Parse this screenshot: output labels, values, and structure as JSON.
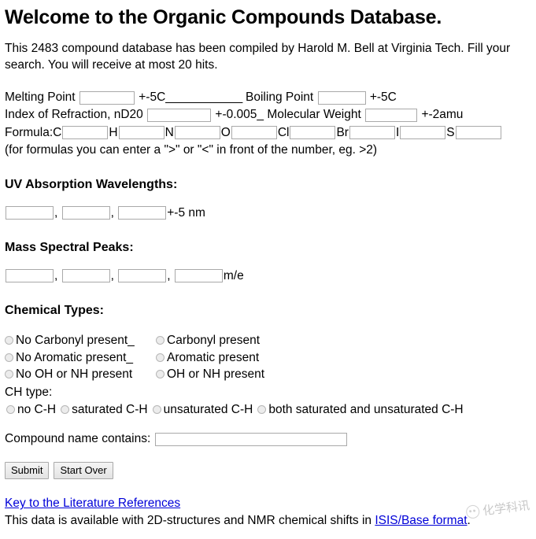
{
  "page": {
    "title": "Welcome to the Organic Compounds Database.",
    "intro": "This 2483 compound database has been compiled by Harold M. Bell at Virginia Tech. Fill your search. You will receive at most 20 hits."
  },
  "physical": {
    "melting_point_label": "Melting Point",
    "melting_point_value": "",
    "melting_point_tolerance": "+-5C",
    "spacer_underscores": "____________",
    "boiling_point_label": "Boiling Point",
    "boiling_point_value": "",
    "boiling_point_tolerance": "+-5C",
    "refraction_label": "Index of Refraction, nD20",
    "refraction_value": "",
    "refraction_tolerance": "+-0.005_",
    "molecular_weight_label": "Molecular Weight",
    "molecular_weight_value": "",
    "molecular_weight_tolerance": "+-2amu"
  },
  "formula": {
    "label": "Formula:",
    "note": "(for formulas you can enter a \">\" or \"<\" in front of the number, eg. >2)",
    "elements": [
      {
        "symbol": "C",
        "value": ""
      },
      {
        "symbol": "H",
        "value": ""
      },
      {
        "symbol": "N",
        "value": ""
      },
      {
        "symbol": "O",
        "value": ""
      },
      {
        "symbol": "Cl",
        "value": ""
      },
      {
        "symbol": "Br",
        "value": ""
      },
      {
        "symbol": "I",
        "value": ""
      },
      {
        "symbol": "S",
        "value": ""
      }
    ]
  },
  "uv": {
    "heading": "UV Absorption Wavelengths:",
    "values": [
      "",
      "",
      ""
    ],
    "separator": ",",
    "units": "+-5 nm"
  },
  "ms": {
    "heading": "Mass Spectral Peaks:",
    "values": [
      "",
      "",
      "",
      ""
    ],
    "separator": ",",
    "units": "m/e"
  },
  "chemical_types": {
    "heading": "Chemical Types:",
    "rows": [
      {
        "negative": "No Carbonyl present_",
        "positive": "Carbonyl present"
      },
      {
        "negative": "No Aromatic present_",
        "positive": "Aromatic present"
      },
      {
        "negative": "No OH or NH present",
        "positive": "OH or NH present"
      }
    ],
    "ch_type_label": "CH type:",
    "ch_options": [
      "no C-H",
      "saturated C-H",
      "unsaturated C-H",
      "both saturated and unsaturated C-H"
    ]
  },
  "compound": {
    "label": "Compound name contains:",
    "value": "",
    "placeholder": ""
  },
  "buttons": {
    "submit": "Submit",
    "start_over": "Start Over"
  },
  "footer": {
    "key_link": "Key to the Literature References",
    "availability_prefix": "This data is available with 2D-structures and NMR chemical shifts in ",
    "isis_link": "ISIS/Base format",
    "availability_suffix": ".",
    "link_color": "#0000d8"
  },
  "watermark": {
    "text": "化学科讯"
  }
}
